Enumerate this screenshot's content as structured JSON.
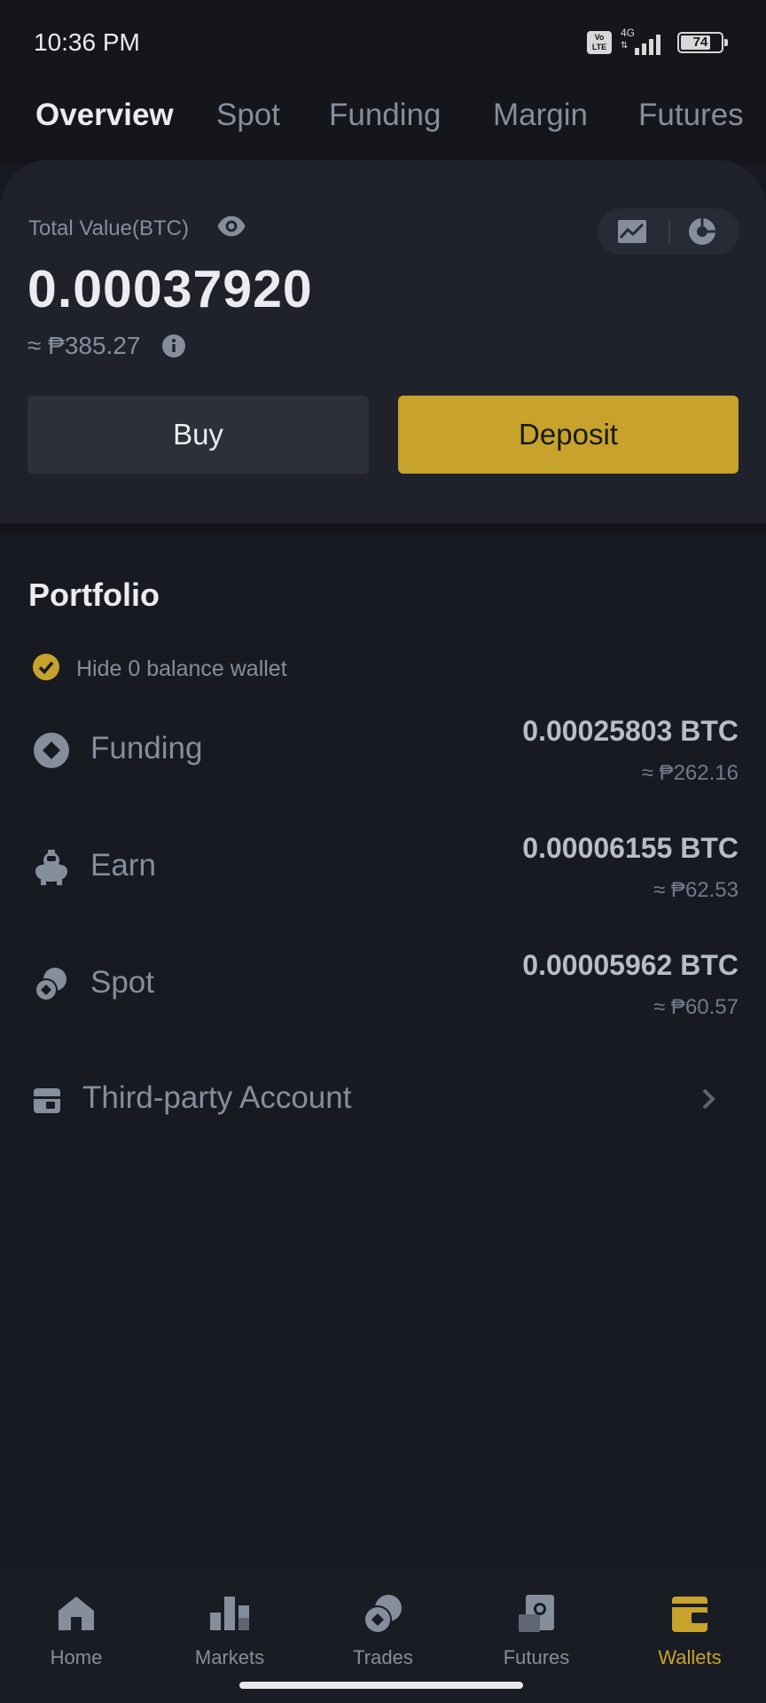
{
  "status_bar": {
    "time": "10:36 PM",
    "volte_line1": "Vo",
    "volte_line2": "LTE",
    "network": "4G",
    "battery": "74",
    "battery_level": 0.74
  },
  "tabs": [
    "Overview",
    "Spot",
    "Funding",
    "Margin",
    "Futures"
  ],
  "active_tab": "Overview",
  "summary": {
    "total_label": "Total Value(BTC)",
    "total_value": "0.00037920",
    "fiat_value": "≈ ₱385.27",
    "buy_label": "Buy",
    "deposit_label": "Deposit"
  },
  "portfolio": {
    "title": "Portfolio",
    "hide_zero_label": "Hide 0 balance wallet",
    "hide_zero_checked": true,
    "accounts": [
      {
        "label": "Funding",
        "icon": "funding-icon",
        "amount": "0.00025803 BTC",
        "fiat": "≈ ₱262.16"
      },
      {
        "label": "Earn",
        "icon": "earn-icon",
        "amount": "0.00006155 BTC",
        "fiat": "≈ ₱62.53"
      },
      {
        "label": "Spot",
        "icon": "spot-icon",
        "amount": "0.00005962 BTC",
        "fiat": "≈ ₱60.57"
      }
    ],
    "third_party_label": "Third-party Account"
  },
  "bottom_nav": [
    {
      "label": "Home",
      "icon": "home-icon"
    },
    {
      "label": "Markets",
      "icon": "markets-icon"
    },
    {
      "label": "Trades",
      "icon": "trades-icon"
    },
    {
      "label": "Futures",
      "icon": "futures-icon"
    },
    {
      "label": "Wallets",
      "icon": "wallets-icon"
    }
  ],
  "active_nav": "Wallets",
  "colors": {
    "background": "#181a22",
    "card": "#1f222b",
    "accent": "#c7a22c",
    "text_primary": "#eaecef",
    "text_secondary": "#848e9c"
  }
}
